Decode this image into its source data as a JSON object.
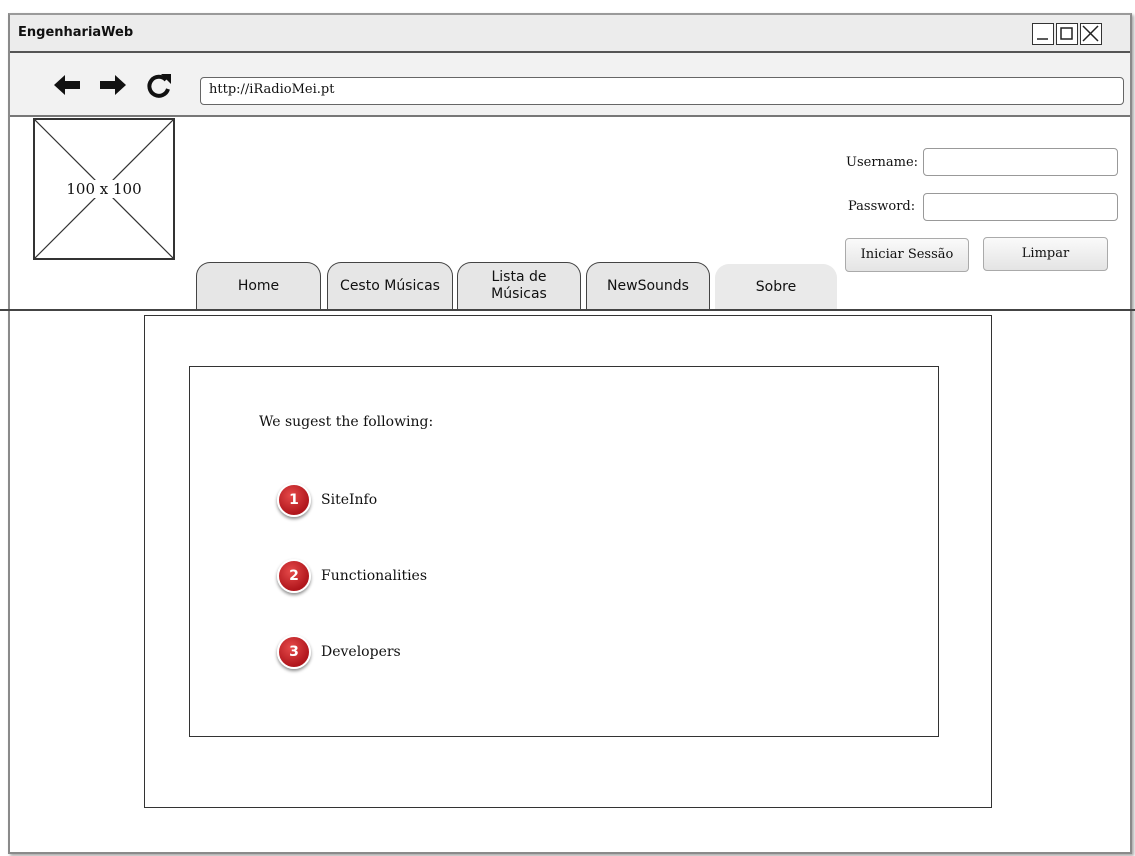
{
  "window": {
    "title": "EngenhariaWeb"
  },
  "browser": {
    "url": "http://iRadioMei.pt"
  },
  "logo": {
    "label": "100 x 100"
  },
  "login": {
    "username_label": "Username:",
    "password_label": "Password:",
    "submit_label": "Iniciar Sessão",
    "clear_label": "Limpar"
  },
  "tabs": [
    {
      "label": "Home"
    },
    {
      "label": "Cesto Músicas"
    },
    {
      "label": "Lista de\nMúsicas"
    },
    {
      "label": "NewSounds"
    },
    {
      "label": "Sobre",
      "active": true
    }
  ],
  "content": {
    "intro": "We sugest the following:",
    "items": [
      {
        "number": "1",
        "label": "SiteInfo"
      },
      {
        "number": "2",
        "label": "Functionalities"
      },
      {
        "number": "3",
        "label": "Developers"
      }
    ]
  }
}
